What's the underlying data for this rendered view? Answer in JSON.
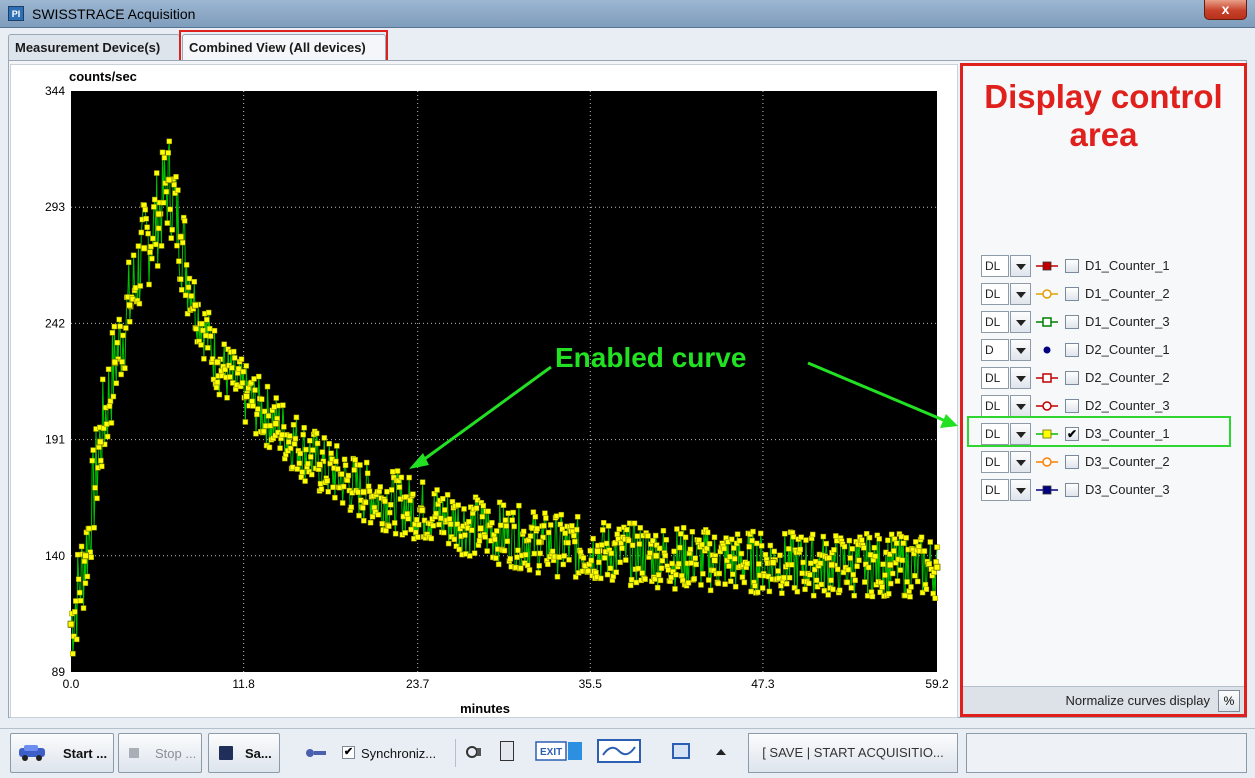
{
  "window": {
    "title": "SWISSTRACE Acquisition",
    "icon_text": "PI",
    "close_label": "x"
  },
  "tabs": [
    {
      "label": "Measurement Device(s)"
    },
    {
      "label": "Combined View (All devices)"
    }
  ],
  "chart_data": {
    "type": "line",
    "ylabel": "counts/sec",
    "xlabel": "minutes",
    "xlim": [
      0.0,
      59.2
    ],
    "ylim": [
      89,
      344
    ],
    "xticks": [
      "0.0",
      "11.8",
      "23.7",
      "35.5",
      "47.3",
      "59.2"
    ],
    "yticks": [
      "89",
      "140",
      "191",
      "242",
      "293",
      "344"
    ],
    "grid": true,
    "series": [
      {
        "name": "D3_Counter_1",
        "marker": "square",
        "color": "#ffff00",
        "line_color": "#00c000",
        "x": [
          0.0,
          1.0,
          2.0,
          3.0,
          4.0,
          5.0,
          6.0,
          6.7,
          7.5,
          8.5,
          10.0,
          12.0,
          14.0,
          17.0,
          20.0,
          24.0,
          28.0,
          32.0,
          36.0,
          40.0,
          44.0,
          48.0,
          52.0,
          56.0,
          59.2
        ],
        "values": [
          110,
          140,
          190,
          225,
          250,
          275,
          290,
          305,
          280,
          250,
          225,
          210,
          198,
          180,
          168,
          160,
          152,
          146,
          142,
          140,
          138,
          137,
          136,
          136,
          135
        ]
      }
    ]
  },
  "annotations": {
    "enabled_curve": "Enabled curve",
    "display_control": "Display control area"
  },
  "controls": {
    "rows": [
      {
        "mode": "DL",
        "label": "D1_Counter_1",
        "checked": false,
        "marker": "filled-square",
        "color": "#c00000"
      },
      {
        "mode": "DL",
        "label": "D1_Counter_2",
        "checked": false,
        "marker": "circle",
        "color": "#e0a000"
      },
      {
        "mode": "DL",
        "label": "D1_Counter_3",
        "checked": false,
        "marker": "square",
        "color": "#008000"
      },
      {
        "mode": "D",
        "label": "D2_Counter_1",
        "checked": false,
        "marker": "dot",
        "color": "#000080"
      },
      {
        "mode": "DL",
        "label": "D2_Counter_2",
        "checked": false,
        "marker": "square",
        "color": "#c00000"
      },
      {
        "mode": "DL",
        "label": "D2_Counter_3",
        "checked": false,
        "marker": "circle",
        "color": "#c00000"
      },
      {
        "mode": "DL",
        "label": "D3_Counter_1",
        "checked": true,
        "marker": "square",
        "color": "#ffff00"
      },
      {
        "mode": "DL",
        "label": "D3_Counter_2",
        "checked": false,
        "marker": "circle",
        "color": "#ff8000"
      },
      {
        "mode": "DL",
        "label": "D3_Counter_3",
        "checked": false,
        "marker": "filled-square",
        "color": "#000080"
      }
    ],
    "normalize_label": "Normalize curves display",
    "normalize_button": "%"
  },
  "toolbar": {
    "start": "Start ...",
    "stop": "Stop ...",
    "save": "Sa...",
    "synchronize": "Synchroniz...",
    "start_acquisition": "[ SAVE | START ACQUISITIO...",
    "exit_label": "EXIT"
  }
}
